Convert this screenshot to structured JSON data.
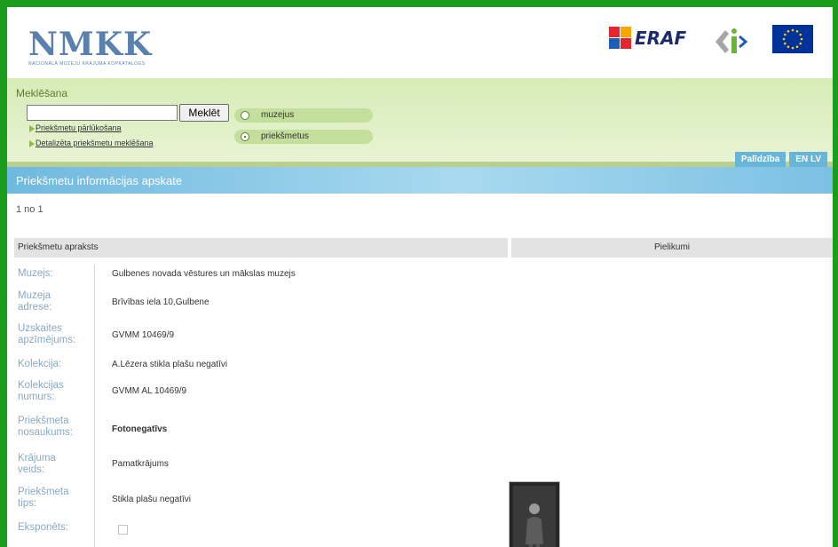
{
  "header": {
    "logo_main": "NMKK",
    "logo_sub": "NACIONĀLĀ MUZEJU KRĀJUMA KOPKATALOGS",
    "eraf_text": "ERAF"
  },
  "search": {
    "label": "Meklēšana",
    "input_value": "",
    "button": "Meklēt",
    "links": [
      "Priekšmetu pārlūkošana",
      "Detalizēta priekšmetu meklēšana"
    ],
    "radios": [
      {
        "label": "muzejus",
        "selected": false
      },
      {
        "label": "priekšmetus",
        "selected": true
      }
    ]
  },
  "tabs": [
    "Palīdzība",
    "EN LV"
  ],
  "page_title": "Priekšmetu informācijas apskate",
  "pagination": "1 no 1",
  "columns": [
    "Priekšmetu apraksts",
    "Pielikumi"
  ],
  "fields": [
    {
      "label": "Muzejs:",
      "value": "Gulbenes novada vēstures un mākslas muzejs"
    },
    {
      "label": "Muzeja adrese:",
      "value": "Brīvības iela 10,Gulbene"
    },
    {
      "label": "Uzskaites apzīmējums:",
      "value": "GVMM 10469/9"
    },
    {
      "label": "Kolekcija:",
      "value": "A.Lēzera stikla plašu negatīvi"
    },
    {
      "label": "Kolekcijas numurs:",
      "value": "GVMM AL 10469/9"
    },
    {
      "label": "Priekšmeta nosaukums:",
      "value": "Fotonegatīvs"
    },
    {
      "label": "Krājuma veids:",
      "value": "Pamatkrājums"
    },
    {
      "label": "Priekšmeta tips:",
      "value": "Stikla plašu negatīvi"
    },
    {
      "label": "Eksponēts:",
      "value": ""
    }
  ],
  "colors": {
    "outer_frame": "#1c9c1c",
    "search_bg": "#d6ecb6",
    "title_bar": "#6fb9df",
    "field_label": "#85aac6",
    "logo": "#5a80ad"
  }
}
